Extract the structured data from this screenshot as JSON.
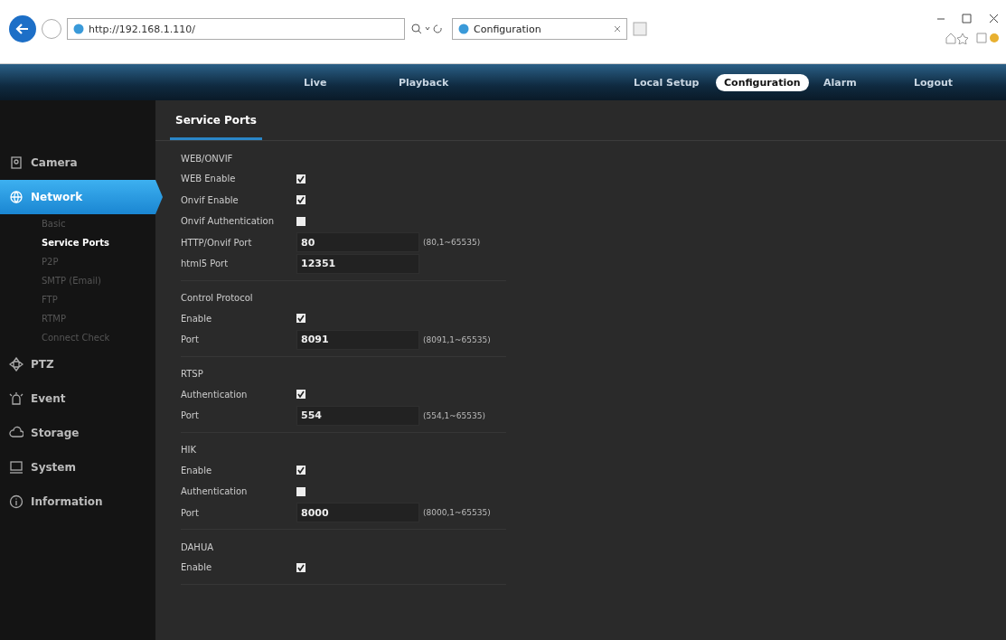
{
  "browser": {
    "address": "http://192.168.1.110/",
    "tab_title": "Configuration"
  },
  "nav": {
    "left": [
      {
        "label": "Live",
        "selected": false
      },
      {
        "label": "Playback",
        "selected": false
      }
    ],
    "right": [
      {
        "label": "Local Setup",
        "selected": false
      },
      {
        "label": "Configuration",
        "selected": true
      },
      {
        "label": "Alarm",
        "selected": false
      },
      {
        "label": "Logout",
        "selected": false
      }
    ]
  },
  "sidebar": {
    "items": [
      {
        "label": "Camera",
        "selected": false
      },
      {
        "label": "Network",
        "selected": true,
        "children": [
          {
            "label": "Basic",
            "selected": false
          },
          {
            "label": "Service Ports",
            "selected": true
          },
          {
            "label": "P2P",
            "selected": false
          },
          {
            "label": "SMTP (Email)",
            "selected": false
          },
          {
            "label": "FTP",
            "selected": false
          },
          {
            "label": "RTMP",
            "selected": false
          },
          {
            "label": "Connect Check",
            "selected": false
          }
        ]
      },
      {
        "label": "PTZ",
        "selected": false
      },
      {
        "label": "Event",
        "selected": false
      },
      {
        "label": "Storage",
        "selected": false
      },
      {
        "label": "System",
        "selected": false
      },
      {
        "label": "Information",
        "selected": false
      }
    ]
  },
  "page_title": "Service Ports",
  "sections": [
    {
      "title": "WEB/ONVIF",
      "rows": [
        {
          "kind": "checkbox",
          "label": "WEB Enable",
          "checked": true
        },
        {
          "kind": "checkbox",
          "label": "Onvif Enable",
          "checked": true
        },
        {
          "kind": "checkbox",
          "label": "Onvif Authentication",
          "checked": false
        },
        {
          "kind": "field",
          "label": "HTTP/Onvif Port",
          "value": "80",
          "hint": "(80,1~65535)"
        },
        {
          "kind": "field",
          "label": "html5 Port",
          "value": "12351"
        }
      ]
    },
    {
      "title": "Control Protocol",
      "rows": [
        {
          "kind": "checkbox",
          "label": "Enable",
          "checked": true
        },
        {
          "kind": "field",
          "label": "Port",
          "value": "8091",
          "hint": "(8091,1~65535)"
        }
      ]
    },
    {
      "title": "RTSP",
      "rows": [
        {
          "kind": "checkbox",
          "label": "Authentication",
          "checked": true
        },
        {
          "kind": "field",
          "label": "Port",
          "value": "554",
          "hint": "(554,1~65535)"
        }
      ]
    },
    {
      "title": "HIK",
      "rows": [
        {
          "kind": "checkbox",
          "label": "Enable",
          "checked": true
        },
        {
          "kind": "checkbox",
          "label": "Authentication",
          "checked": false
        },
        {
          "kind": "field",
          "label": "Port",
          "value": "8000",
          "hint": "(8000,1~65535)"
        }
      ]
    },
    {
      "title": "DAHUA",
      "rows": [
        {
          "kind": "checkbox",
          "label": "Enable",
          "checked": true
        }
      ]
    }
  ]
}
